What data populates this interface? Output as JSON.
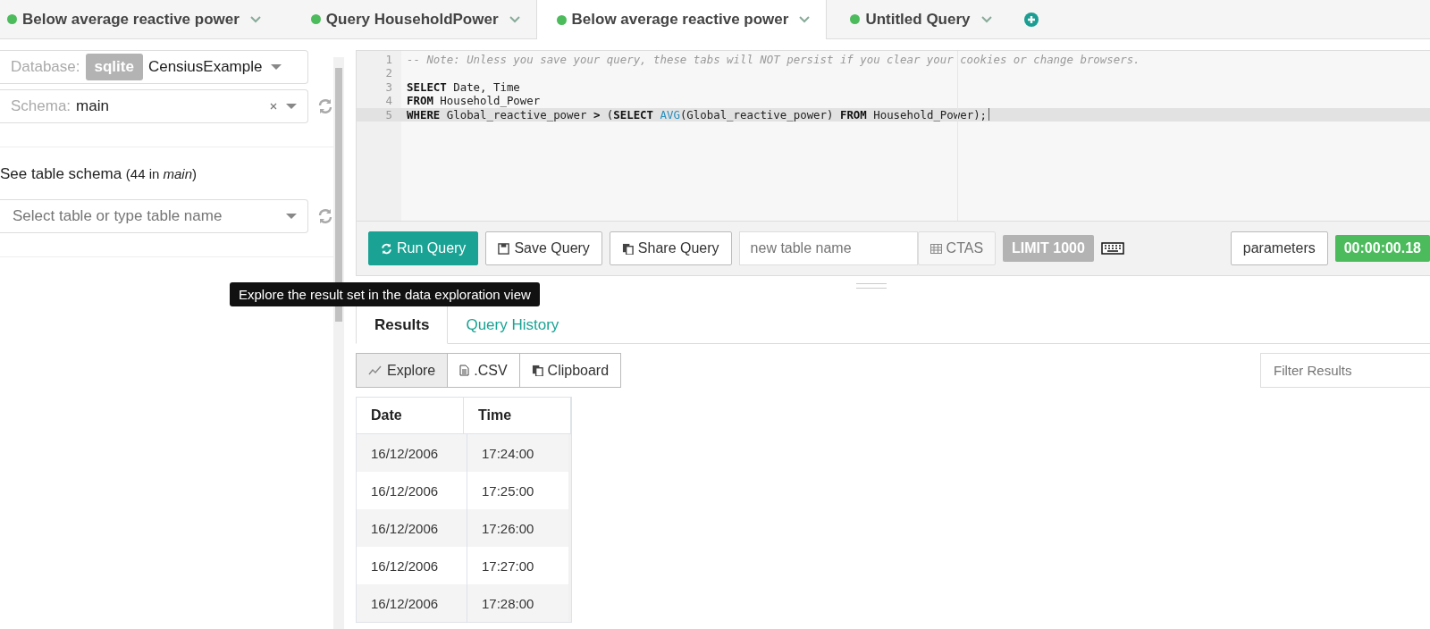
{
  "tabs": [
    {
      "label": "Below average reactive power",
      "selected": false
    },
    {
      "label": "Query HouseholdPower",
      "selected": false
    },
    {
      "label": "Below average reactive power",
      "selected": true
    },
    {
      "label": "Untitled Query",
      "selected": false
    }
  ],
  "sidebar": {
    "database": {
      "label": "Database:",
      "engine": "sqlite",
      "value": "CensiusExample"
    },
    "schema": {
      "label": "Schema:",
      "value": "main"
    },
    "table_schema": {
      "label": "See table schema",
      "count": "(44 in *main*)"
    },
    "table_select": {
      "placeholder": "Select table or type table name"
    }
  },
  "editor": {
    "lines": [
      {
        "number": "1",
        "active": false,
        "segments": [
          {
            "kind": "comment",
            "text": "-- Note: Unless you save your query, these tabs will NOT persist if you clear your cookies or change browsers."
          }
        ]
      },
      {
        "number": "2",
        "active": false
      },
      {
        "number": "3",
        "active": false,
        "segments": [
          {
            "kind": "keyword",
            "text": "SELECT"
          },
          {
            "kind": "plain",
            "text": " Date, Time"
          }
        ]
      },
      {
        "number": "4",
        "active": false,
        "segments": [
          {
            "kind": "keyword",
            "text": "FROM"
          },
          {
            "kind": "plain",
            "text": " Household_Power"
          }
        ]
      },
      {
        "number": "5",
        "active": true,
        "segments": [
          {
            "kind": "keyword",
            "text": "WHERE"
          },
          {
            "kind": "plain",
            "text": " Global_reactive_power "
          },
          {
            "kind": "keyword",
            "text": ">"
          },
          {
            "kind": "plain",
            "text": " ("
          },
          {
            "kind": "keyword",
            "text": "SELECT "
          },
          {
            "kind": "function",
            "text": "AVG"
          },
          {
            "kind": "plain",
            "text": "(Global_reactive_power) "
          },
          {
            "kind": "keyword",
            "text": "FROM"
          },
          {
            "kind": "plain",
            "text": " Household_Power);"
          }
        ]
      }
    ]
  },
  "toolbar": {
    "run": "Run Query",
    "save": "Save Query",
    "share": "Share Query",
    "table_name": {
      "placeholder": "new table name"
    },
    "ctas": "CTAS",
    "limit": "LIMIT 1000",
    "parameters": "parameters",
    "timer": "00:00:00.18"
  },
  "result_tabs": [
    {
      "label": "Results",
      "selected": true
    },
    {
      "label": "Query History",
      "selected": false
    }
  ],
  "tooltip": "Explore the result set in the data exploration view",
  "result_actions": {
    "explore": "Explore",
    "csv": ".CSV",
    "clipboard": "Clipboard",
    "filter": {
      "placeholder": "Filter Results"
    }
  },
  "table": {
    "columns": [
      "Date",
      "Time"
    ],
    "rows": [
      [
        "16/12/2006",
        "17:24:00"
      ],
      [
        "16/12/2006",
        "17:25:00"
      ],
      [
        "16/12/2006",
        "17:26:00"
      ],
      [
        "16/12/2006",
        "17:27:00"
      ],
      [
        "16/12/2006",
        "17:28:00"
      ]
    ]
  }
}
